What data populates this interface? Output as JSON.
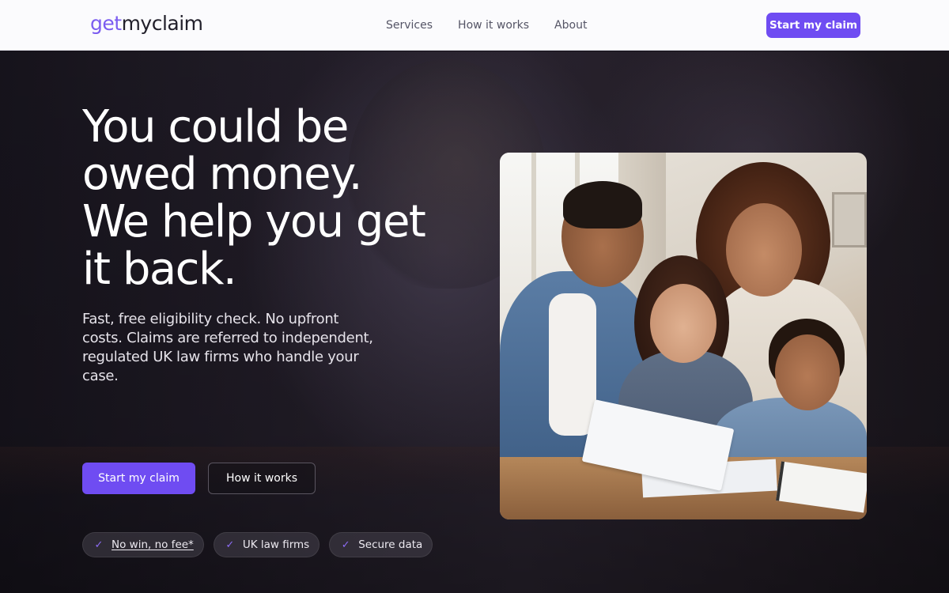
{
  "nav": {
    "logo": {
      "part1": "get",
      "part2": "myclaim"
    },
    "links": [
      "Services",
      "How it works",
      "About"
    ],
    "cta_label": "Start my claim"
  },
  "hero": {
    "headline": "You could be owed money. We help you get it back.",
    "subtext": "Fast, free eligibility check. No upfront costs. Claims are referred to independent, regulated UK law firms who handle your case.",
    "primary_button": "Start my claim",
    "secondary_button": "How it works",
    "badges": [
      {
        "label": "No win, no fee*",
        "icon": "check-icon"
      },
      {
        "label": "UK law firms",
        "icon": "check-icon"
      },
      {
        "label": "Secure data",
        "icon": "check-icon"
      }
    ]
  },
  "colors": {
    "accent": "#6f4cf2",
    "logo_accent": "#7b5cf0",
    "nav_background": "#fbfbfd",
    "hero_background": "#221d28"
  }
}
